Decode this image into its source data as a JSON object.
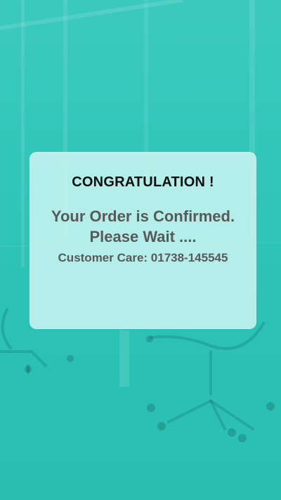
{
  "dialog": {
    "title": "CONGRATULATION !",
    "message_line1": "Your Order is Confirmed.",
    "message_line2": "Please Wait ....",
    "customer_care": "Customer Care: 01738-145545"
  },
  "colors": {
    "background": "#2cc5b8",
    "card": "#cef6f3",
    "title": "#0f0f0f",
    "text": "#595959"
  }
}
